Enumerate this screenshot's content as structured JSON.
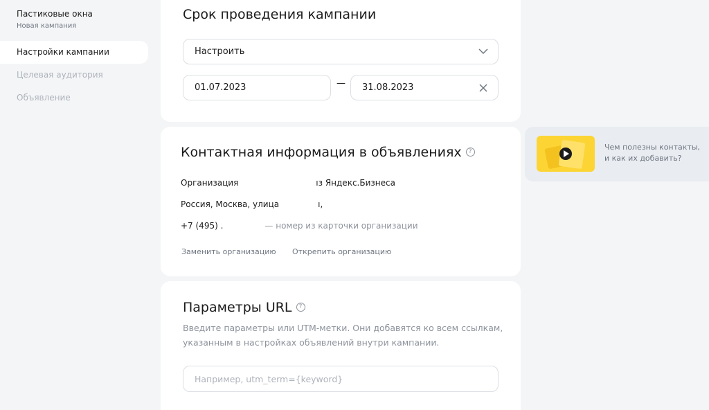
{
  "sidebar": {
    "title": "Пастиковые окна",
    "subtitle": "Новая кампания",
    "items": [
      {
        "label": "Настройки кампании",
        "active": true
      },
      {
        "label": "Целевая аудитория",
        "active": false
      },
      {
        "label": "Объявление",
        "active": false
      }
    ]
  },
  "schedule": {
    "title": "Срок проведения кампании",
    "select_value": "Настроить",
    "date_from": "01.07.2023",
    "date_separator": "—",
    "date_to": "31.08.2023"
  },
  "contacts": {
    "title": "Контактная информация в объявлениях",
    "org_label": "Организация",
    "org_source": "ıз Яндекс.Бизнеса",
    "address_prefix": "Россия, Москва, улица",
    "address_suffix": "ı,",
    "phone_prefix": "+7 (495) .",
    "phone_note": "— номер из карточки организации",
    "replace_link": "Заменить организацию",
    "detach_link": "Открепить организацию"
  },
  "url_params": {
    "title": "Параметры URL",
    "description": "Введите параметры или UTM-метки. Они добавятся ко всем ссылкам, указанным в настройках объявлений внутри кампании.",
    "placeholder": "Например, utm_term={keyword}"
  },
  "video_tip": {
    "text": "Чем полезны контакты, и как их добавить?"
  },
  "colors": {
    "background": "#f4f5f7",
    "card": "#ffffff",
    "accent_yellow": "#fcd535",
    "muted_text": "#8d939c"
  },
  "icons": [
    "chevron-down-icon",
    "close-icon",
    "help-icon",
    "play-icon"
  ]
}
